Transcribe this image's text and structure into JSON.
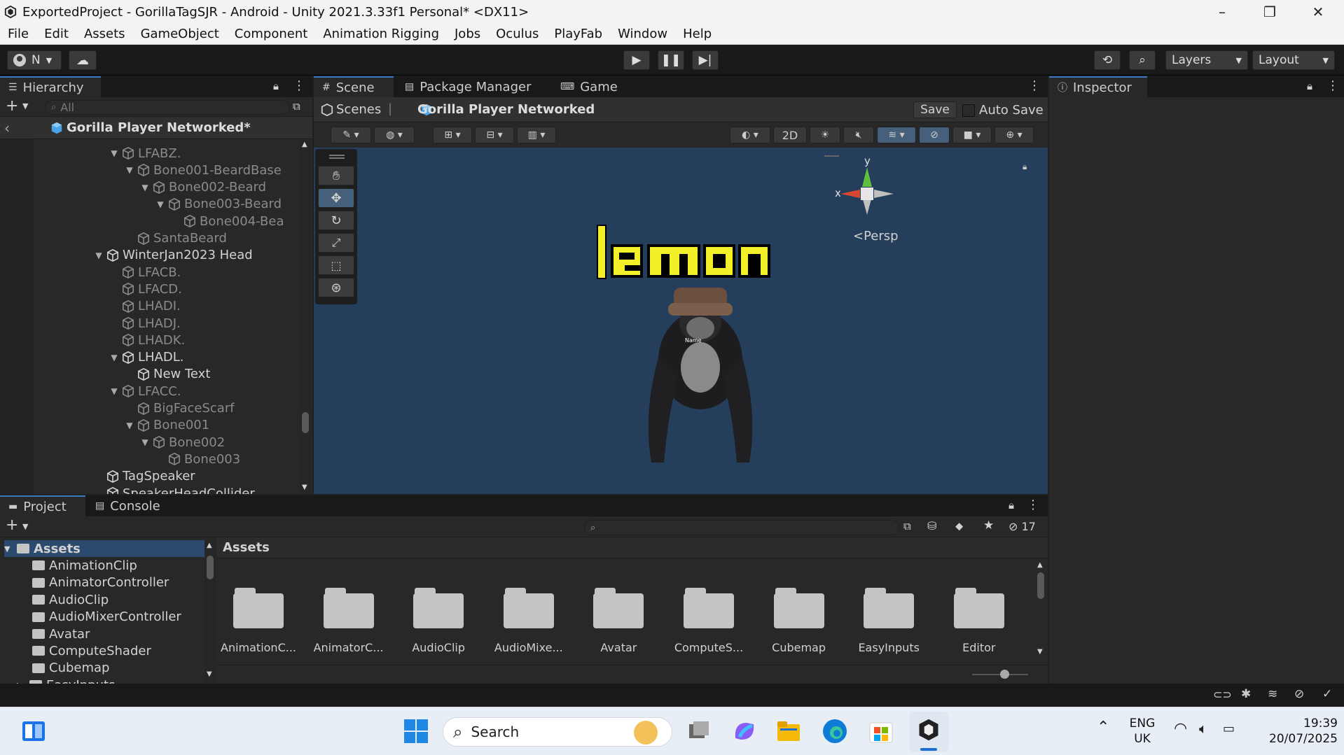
{
  "window": {
    "title": "ExportedProject - GorillaTagSJR - Android - Unity 2021.3.33f1 Personal* <DX11>",
    "minimize": "–",
    "restore": "❐",
    "close": "✕"
  },
  "menu": [
    "File",
    "Edit",
    "Assets",
    "GameObject",
    "Component",
    "Animation Rigging",
    "Jobs",
    "Oculus",
    "PlayFab",
    "Window",
    "Help"
  ],
  "toolbar": {
    "account": "N",
    "layers": "Layers",
    "layout": "Layout"
  },
  "hierarchy": {
    "tab": "Hierarchy",
    "search_placeholder": "All",
    "prefab_title": "Gorilla Player Networked*",
    "rows": [
      {
        "label": "LFABZ.",
        "indent": 8,
        "arrow": "▼",
        "dim": true
      },
      {
        "label": "Bone001-BeardBase",
        "indent": 9,
        "arrow": "▼",
        "dim": true
      },
      {
        "label": "Bone002-Beard",
        "indent": 10,
        "arrow": "▼",
        "dim": true
      },
      {
        "label": "Bone003-Beard",
        "indent": 11,
        "arrow": "▼",
        "dim": true
      },
      {
        "label": "Bone004-Bea",
        "indent": 12,
        "arrow": "",
        "dim": true
      },
      {
        "label": "SantaBeard",
        "indent": 9,
        "arrow": "",
        "dim": true
      },
      {
        "label": "WinterJan2023 Head",
        "indent": 7,
        "arrow": "▼",
        "dim": false
      },
      {
        "label": "LFACB.",
        "indent": 8,
        "arrow": "",
        "dim": true
      },
      {
        "label": "LFACD.",
        "indent": 8,
        "arrow": "",
        "dim": true
      },
      {
        "label": "LHADI.",
        "indent": 8,
        "arrow": "",
        "dim": true
      },
      {
        "label": "LHADJ.",
        "indent": 8,
        "arrow": "",
        "dim": true
      },
      {
        "label": "LHADK.",
        "indent": 8,
        "arrow": "",
        "dim": true
      },
      {
        "label": "LHADL.",
        "indent": 8,
        "arrow": "▼",
        "dim": false
      },
      {
        "label": "New Text",
        "indent": 9,
        "arrow": "",
        "dim": false
      },
      {
        "label": "LFACC.",
        "indent": 8,
        "arrow": "▼",
        "dim": true
      },
      {
        "label": "BigFaceScarf",
        "indent": 9,
        "arrow": "",
        "dim": true
      },
      {
        "label": "Bone001",
        "indent": 9,
        "arrow": "▼",
        "dim": true
      },
      {
        "label": "Bone002",
        "indent": 10,
        "arrow": "▼",
        "dim": true
      },
      {
        "label": "Bone003",
        "indent": 11,
        "arrow": "",
        "dim": true
      },
      {
        "label": "TagSpeaker",
        "indent": 7,
        "arrow": "",
        "dim": false
      },
      {
        "label": "SpeakerHeadCollider",
        "indent": 7,
        "arrow": "",
        "dim": false
      }
    ]
  },
  "scene": {
    "tabs": [
      "Scene",
      "Package Manager",
      "Game"
    ],
    "breadcrumb_root": "Scenes",
    "breadcrumb_prefab": "Gorilla Player Networked",
    "save": "Save",
    "auto_save": "Auto Save",
    "mode_2d": "2D",
    "gizmo_x": "x",
    "gizmo_y": "y",
    "persp": "<Persp",
    "sign_text": "lemon",
    "nametag": "Name"
  },
  "inspector": {
    "tab": "Inspector"
  },
  "project": {
    "tabs": [
      "Project",
      "Console"
    ],
    "breadcrumb": "Assets",
    "hidden_count": "17",
    "tree": [
      {
        "label": "Assets",
        "root": true
      },
      {
        "label": "AnimationClip"
      },
      {
        "label": "AnimatorController"
      },
      {
        "label": "AudioClip"
      },
      {
        "label": "AudioMixerController"
      },
      {
        "label": "Avatar"
      },
      {
        "label": "ComputeShader"
      },
      {
        "label": "Cubemap"
      },
      {
        "label": "EasyInputs",
        "collapsed": true
      }
    ],
    "folders": [
      "AnimationC...",
      "AnimatorC...",
      "AudioClip",
      "AudioMixe...",
      "Avatar",
      "ComputeS...",
      "Cubemap",
      "EasyInputs",
      "Editor"
    ]
  },
  "taskbar": {
    "search": "Search",
    "lang": "ENG",
    "region": "UK",
    "time": "19:39",
    "date": "20/07/2025"
  },
  "colors": {
    "scene_bg": "#243c5a",
    "accent": "#3a79bb",
    "sign_yellow": "#f3f02a"
  }
}
